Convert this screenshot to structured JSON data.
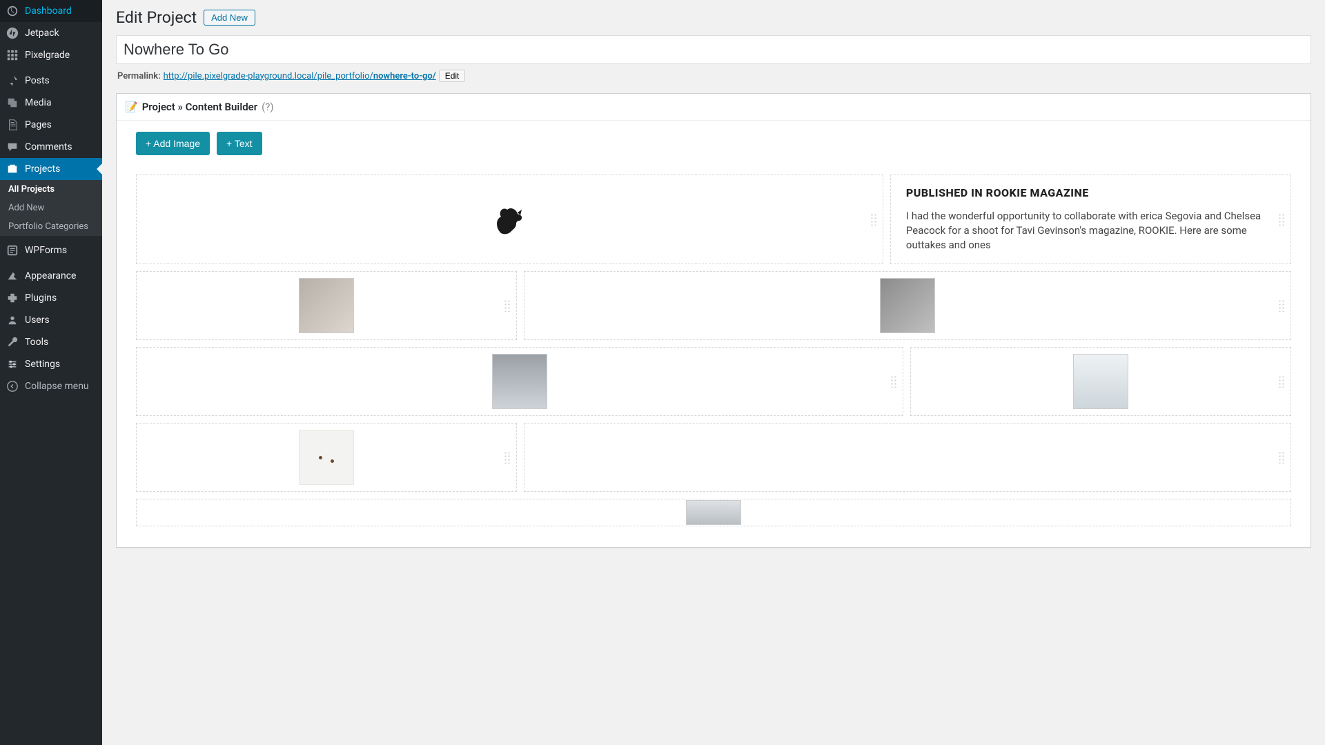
{
  "sidebar": {
    "items": [
      {
        "label": "Dashboard",
        "icon": "dashboard-icon"
      },
      {
        "label": "Jetpack",
        "icon": "jetpack-icon"
      },
      {
        "label": "Pixelgrade",
        "icon": "pixelgrade-icon"
      },
      {
        "label": "Posts",
        "icon": "pin-icon"
      },
      {
        "label": "Media",
        "icon": "media-icon"
      },
      {
        "label": "Pages",
        "icon": "pages-icon"
      },
      {
        "label": "Comments",
        "icon": "comments-icon"
      },
      {
        "label": "Projects",
        "icon": "portfolio-icon",
        "active": true
      },
      {
        "label": "WPForms",
        "icon": "forms-icon"
      },
      {
        "label": "Appearance",
        "icon": "appearance-icon"
      },
      {
        "label": "Plugins",
        "icon": "plugins-icon"
      },
      {
        "label": "Users",
        "icon": "users-icon"
      },
      {
        "label": "Tools",
        "icon": "tools-icon"
      },
      {
        "label": "Settings",
        "icon": "settings-icon"
      }
    ],
    "sub": [
      {
        "label": "All Projects",
        "active": true
      },
      {
        "label": "Add New"
      },
      {
        "label": "Portfolio Categories"
      }
    ],
    "collapse_label": "Collapse menu"
  },
  "header": {
    "title": "Edit Project",
    "add_new": "Add New"
  },
  "post": {
    "title": "Nowhere To Go",
    "permalink_label": "Permalink:",
    "permalink_base": "http://pile.pixelgrade-playground.local/pile_portfolio/",
    "permalink_slug": "nowhere-to-go/",
    "edit_btn": "Edit"
  },
  "builder": {
    "title_prefix_icon": "📝",
    "title": "Project » Content Builder",
    "title_help": "(?)",
    "add_image": "+ Add Image",
    "add_text": "+ Text",
    "text_block": {
      "heading": "PUBLISHED IN ROOKIE MAGAZINE",
      "body": "I had the wonderful opportunity to collaborate with erica Segovia and Chelsea Peacock for a shoot for Tavi Gevinson's magazine, ROOKIE. Here are some outtakes and ones"
    }
  }
}
